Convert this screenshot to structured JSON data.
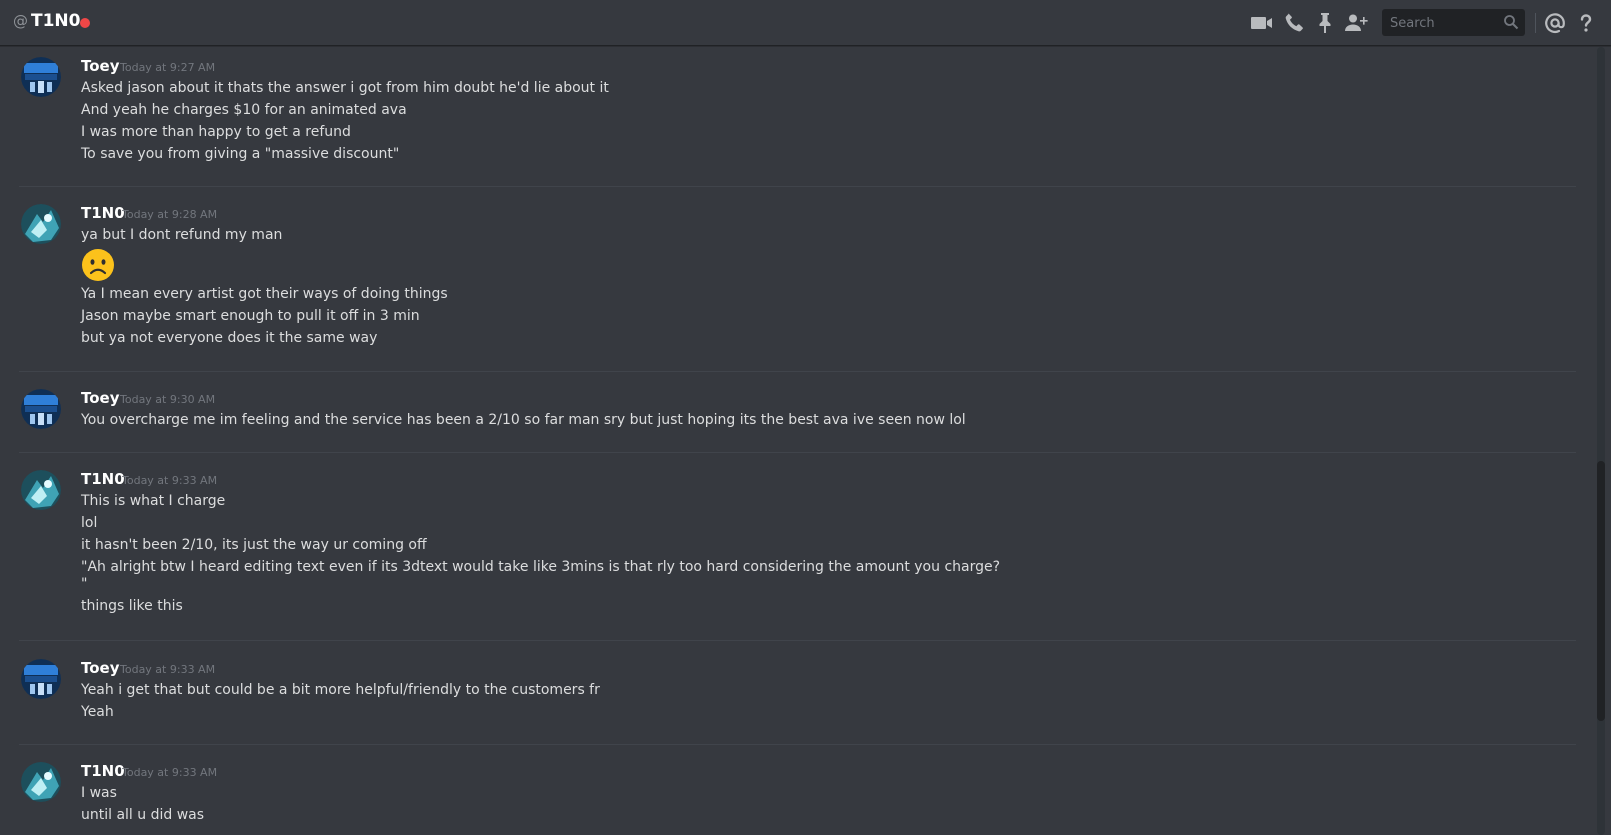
{
  "header": {
    "at_symbol": "@",
    "title": "T1N0",
    "status_color": "#f04747",
    "icons": [
      "video-call-icon",
      "voice-call-icon",
      "pin-icon",
      "add-friend-icon",
      "mention-icon",
      "help-icon"
    ],
    "search_placeholder": "Search"
  },
  "colors": {
    "background": "#36393f",
    "header_background": "#36393f",
    "username": "#ffffff",
    "timestamp": "#72767d",
    "message_text": "#dcddde",
    "search_background": "#202225"
  },
  "messages": [
    {
      "author": "Toey",
      "time": "Today at 9:27 AM",
      "lines": [
        "Asked jason about it thats the answer i got from him doubt he'd lie about it",
        "And yeah he charges $10 for an animated ava",
        "I was more than happy to get a refund",
        "To save you from giving a \"massive discount\""
      ]
    },
    {
      "author": "T1N0",
      "time": "Today at 9:28 AM",
      "lines": [
        "ya but I dont refund my man",
        "Ya I mean every artist got their ways of doing things",
        "Jason maybe smart enough to pull it off in 3 min",
        "but ya not everyone does it the same way"
      ],
      "emoji": "frowning-face-emoji"
    },
    {
      "author": "Toey",
      "time": "Today at 9:30 AM",
      "lines": [
        "You overcharge me im feeling and the service has been a 2/10 so far man sry but just hoping its the best ava ive seen now lol"
      ]
    },
    {
      "author": "T1N0",
      "time": "Today at 9:33 AM",
      "lines": [
        "This is what I charge",
        "lol",
        "it hasn't been 2/10, its just the way ur coming off",
        "\"Ah alright btw I heard editing text even if its 3dtext would take like 3mins is that rly too hard considering the amount you charge?",
        "\"",
        "things like this"
      ]
    },
    {
      "author": "Toey",
      "time": "Today at 9:33 AM",
      "lines": [
        "Yeah i get that but could be a bit more helpful/friendly to the customers fr",
        "Yeah"
      ]
    },
    {
      "author": "T1N0",
      "time": "Today at 9:33 AM",
      "lines": [
        "I was",
        "until all u did was"
      ]
    }
  ]
}
